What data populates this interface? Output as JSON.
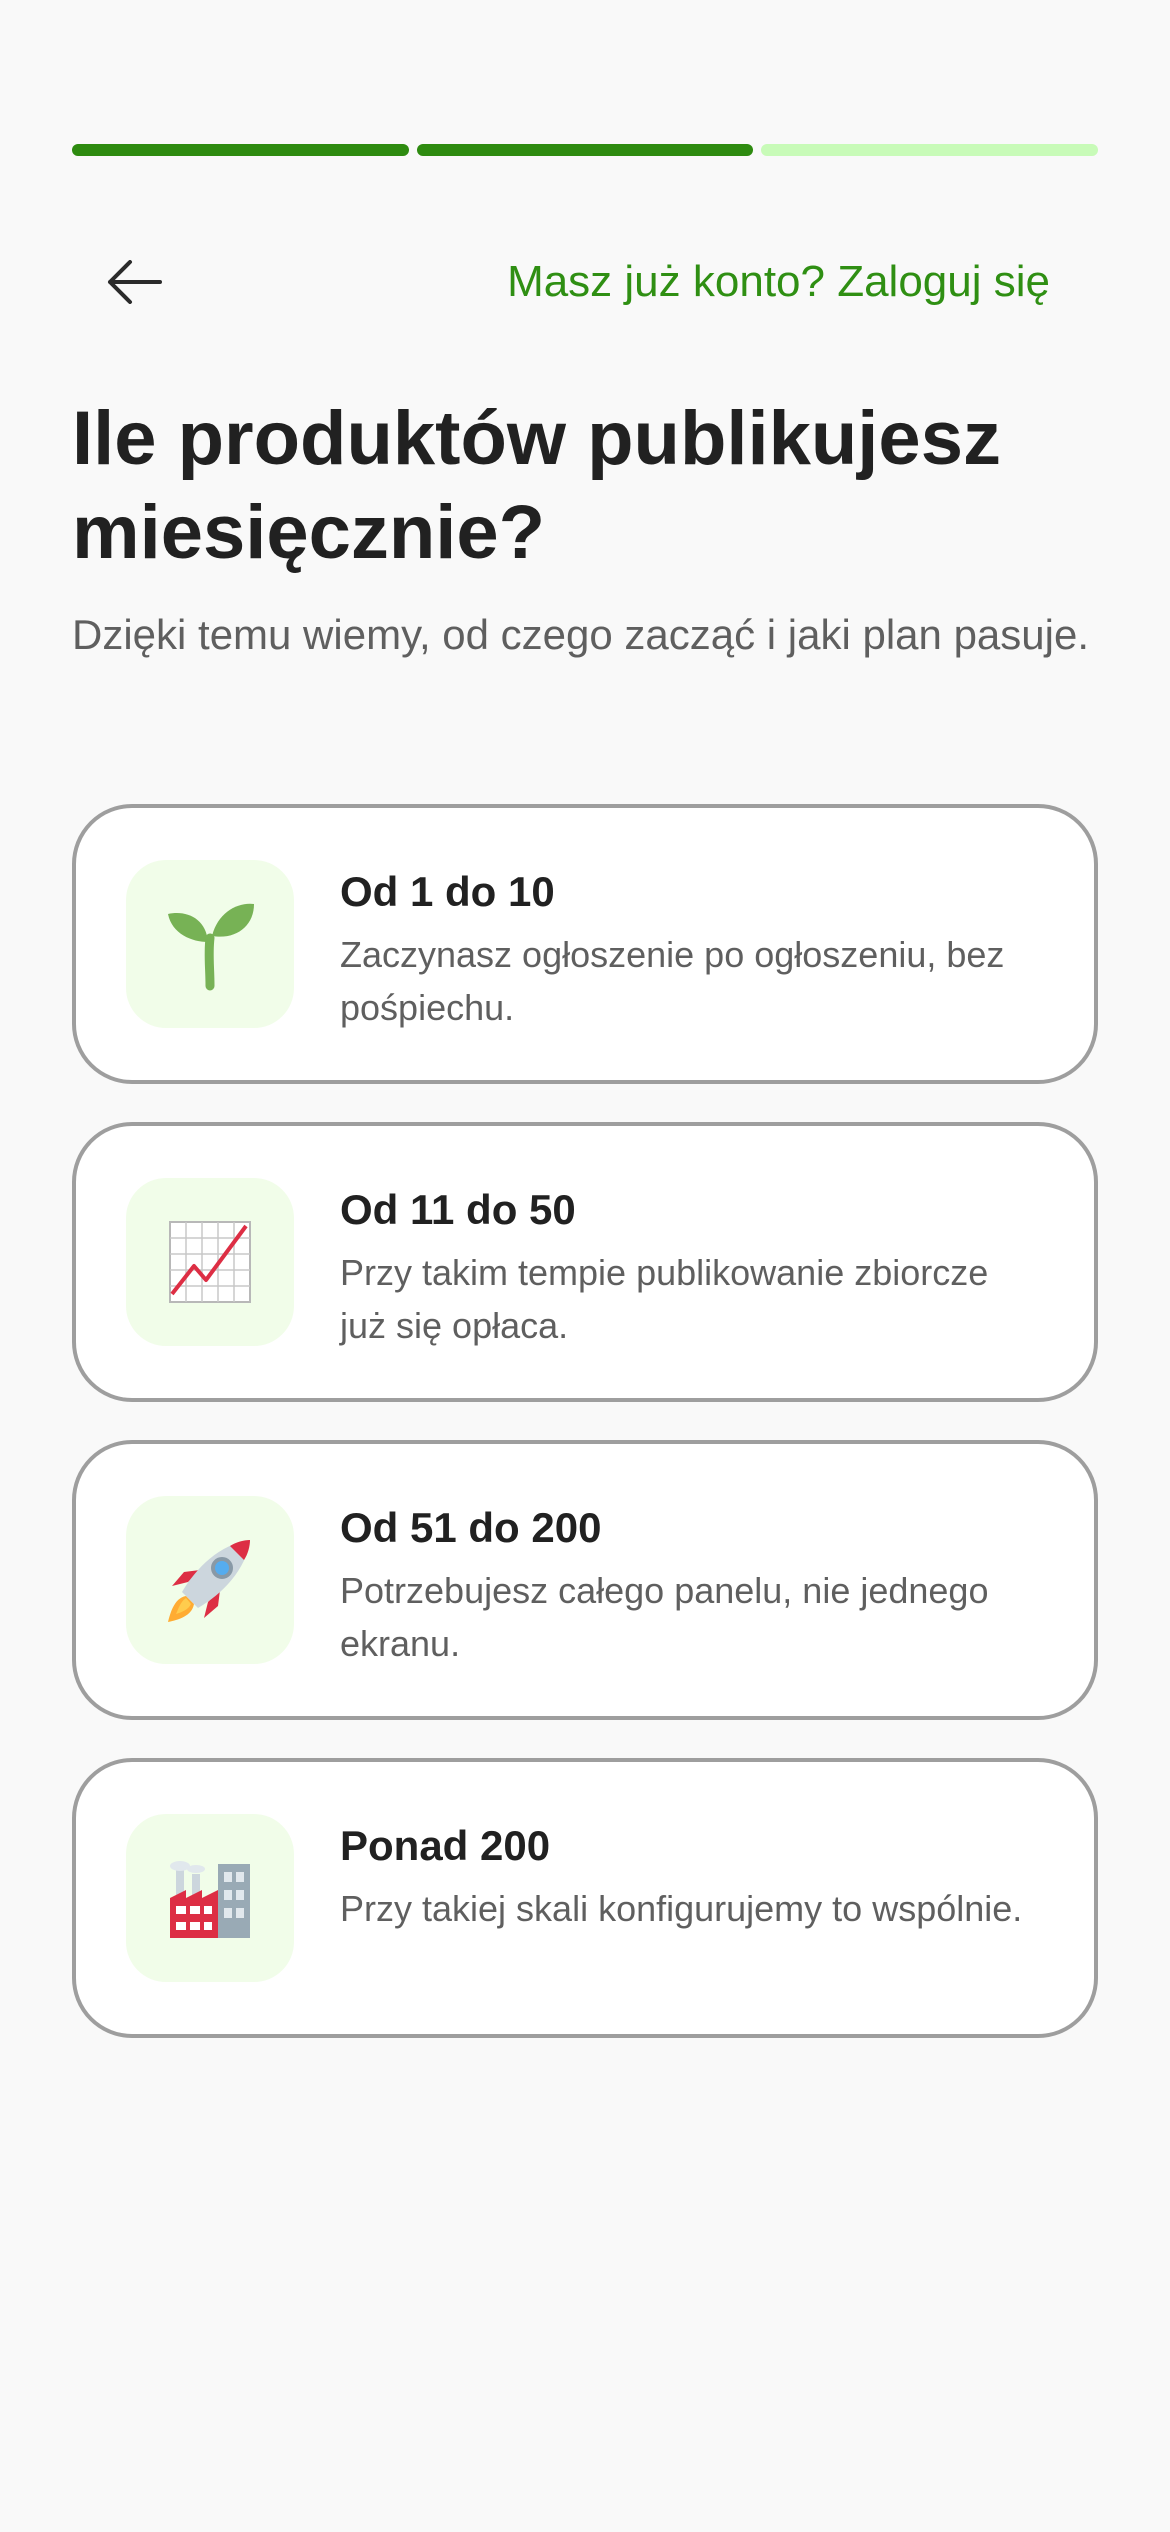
{
  "progress": {
    "total_steps": 3,
    "completed_steps": 2,
    "colors": {
      "completed": "#2e8b10",
      "remaining": "#c8fbb8"
    }
  },
  "header": {
    "back_icon": "arrow-left-icon",
    "login_link": "Masz już konto? Zaloguj się"
  },
  "main": {
    "title": "Ile produktów publikujesz miesięcznie?",
    "subtitle": "Dzięki temu wiemy, od czego zacząć i jaki plan pasuje."
  },
  "options": [
    {
      "icon": "seedling-icon",
      "title": "Od 1 do 10",
      "description": "Zaczynasz ogłoszenie po ogłoszeniu, bez pośpiechu."
    },
    {
      "icon": "chart-increasing-icon",
      "title": "Od 11 do 50",
      "description": "Przy takim tempie publikowanie zbiorcze już się opłaca."
    },
    {
      "icon": "rocket-icon",
      "title": "Od 51 do 200",
      "description": "Potrzebujesz całego panelu, nie jednego ekranu."
    },
    {
      "icon": "factory-icon",
      "title": "Ponad 200",
      "description": "Przy takiej skali konfigurujemy to wspólnie."
    }
  ],
  "colors": {
    "accent": "#2f8f13",
    "icon_background": "#f1fde9",
    "card_border": "#9e9e9e",
    "background": "#f9f9f9"
  }
}
